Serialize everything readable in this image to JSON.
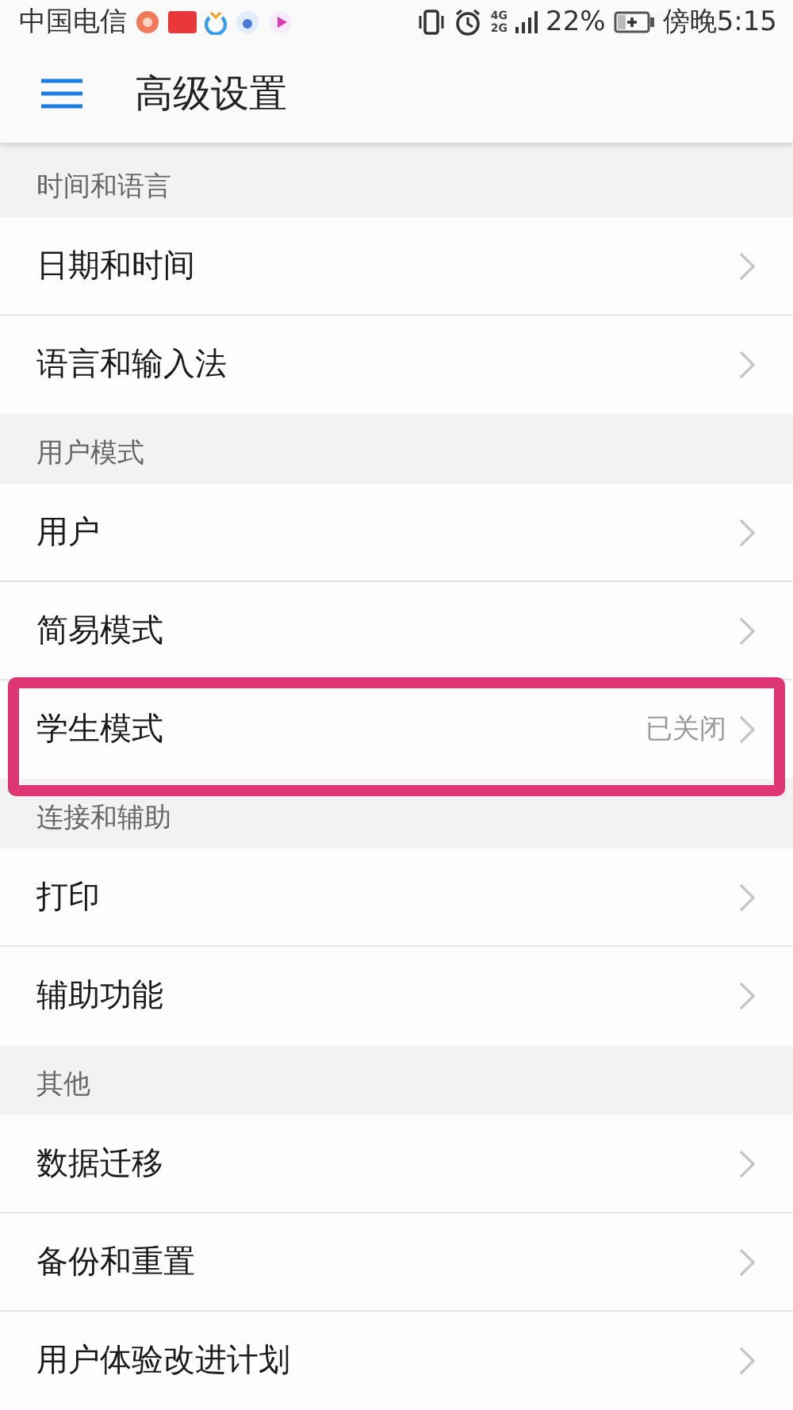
{
  "status_bar": {
    "carrier": "中国电信",
    "network_labels": [
      "4G",
      "2G"
    ],
    "battery_text": "22%",
    "time": "傍晚5:15"
  },
  "header": {
    "title": "高级设置"
  },
  "sections": [
    {
      "title": "时间和语言",
      "items": [
        {
          "label": "日期和时间",
          "highlighted": false
        },
        {
          "label": "语言和输入法",
          "highlighted": false
        }
      ]
    },
    {
      "title": "用户模式",
      "items": [
        {
          "label": "用户",
          "highlighted": false
        },
        {
          "label": "简易模式",
          "highlighted": false
        },
        {
          "label": "学生模式",
          "value": "已关闭",
          "highlighted": true
        }
      ]
    },
    {
      "title": "连接和辅助",
      "items": [
        {
          "label": "打印",
          "highlighted": false
        },
        {
          "label": "辅助功能",
          "highlighted": false
        }
      ]
    },
    {
      "title": "其他",
      "items": [
        {
          "label": "数据迁移",
          "highlighted": false
        },
        {
          "label": "备份和重置",
          "highlighted": false
        },
        {
          "label": "用户体验改进计划",
          "highlighted": false
        }
      ]
    }
  ]
}
